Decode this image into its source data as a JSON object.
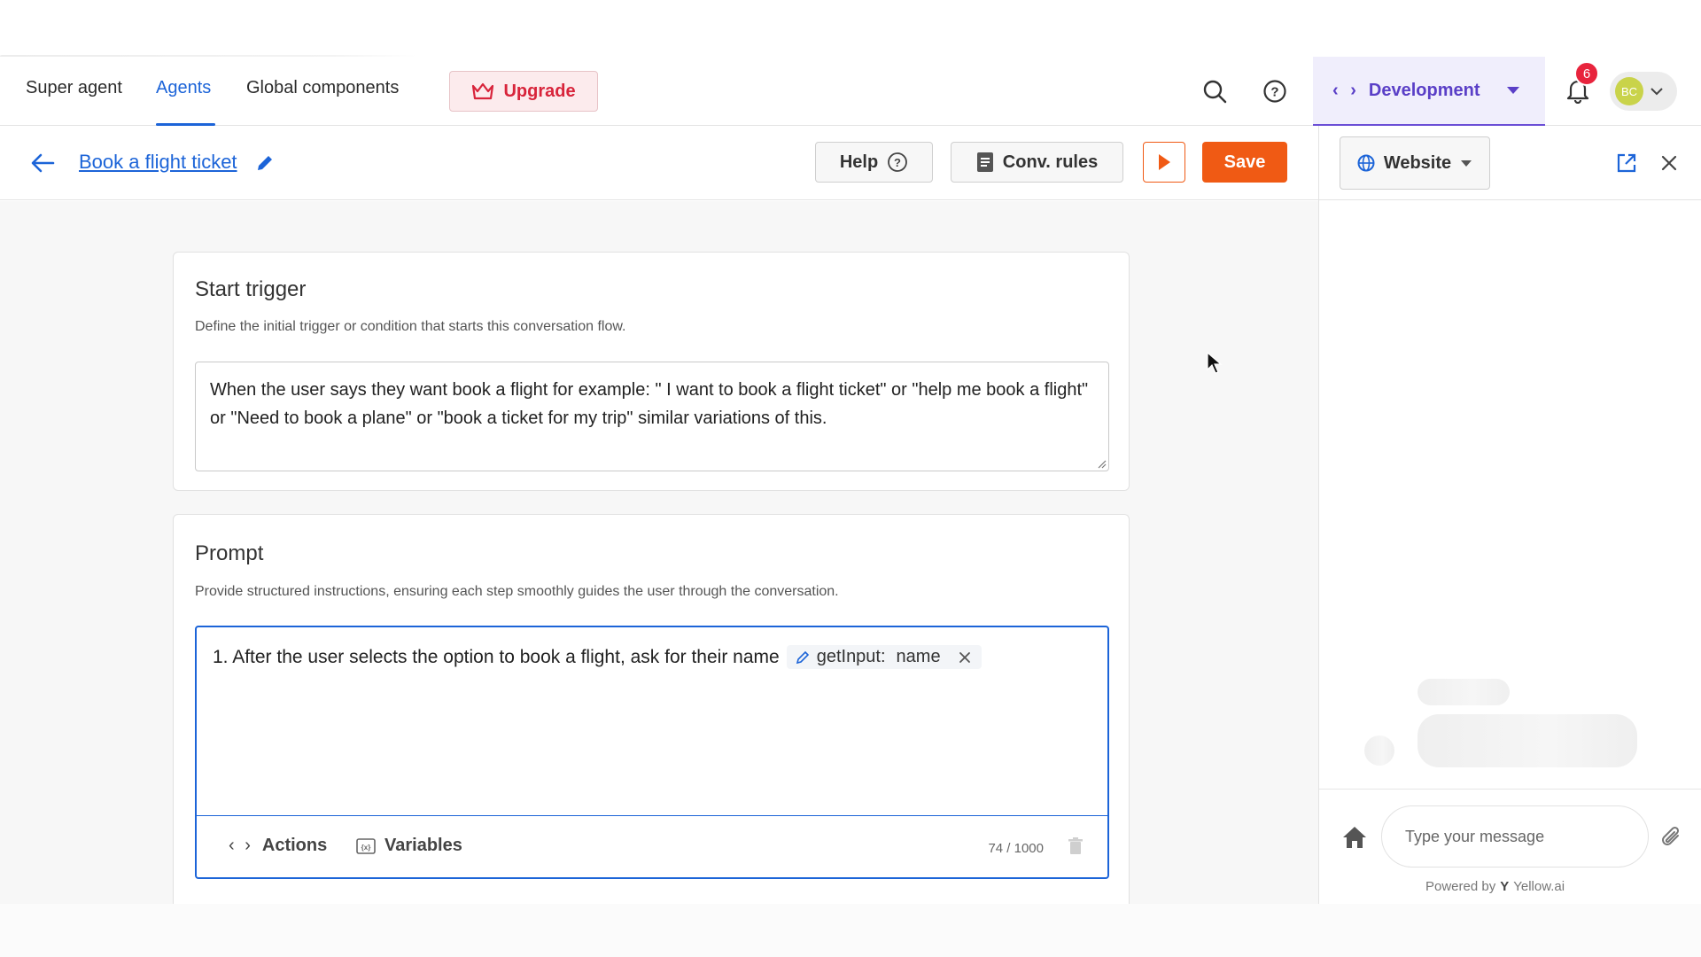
{
  "topnav": {
    "tabs": [
      {
        "label": "Super agent",
        "active": false
      },
      {
        "label": "Agents",
        "active": true
      },
      {
        "label": "Global components",
        "active": false
      }
    ],
    "upgrade_label": "Upgrade",
    "environment_label": "Development",
    "notification_count": "6",
    "avatar_initials": "BC"
  },
  "subbar": {
    "flow_title": "Book a flight ticket",
    "help_label": "Help",
    "conv_rules_label": "Conv. rules",
    "save_label": "Save"
  },
  "start_trigger": {
    "title": "Start trigger",
    "description": "Define the initial trigger or condition that starts this conversation flow.",
    "value": "When the user says they want book a flight for example:  \" I want to book a flight ticket\" or \"help me book a flight\" or \"Need to book a plane\"  or \"book a ticket for my trip\" similar variations of this."
  },
  "prompt": {
    "title": "Prompt",
    "description": "Provide structured instructions, ensuring each step smoothly guides the user through the conversation.",
    "line_text": "1. After the user selects the option to book a flight, ask for their name",
    "chip_function": "getInput:",
    "chip_value": "name",
    "actions_label": "Actions",
    "variables_label": "Variables",
    "char_count": "74 / 1000"
  },
  "preview": {
    "channel_label": "Website",
    "message_placeholder": "Type your message",
    "powered_by": "Powered by",
    "brand": "Yellow.ai"
  },
  "colors": {
    "accent": "#1c64d8",
    "save": "#f05a14",
    "upgrade": "#d8243b",
    "environment": "#5a3fc7"
  }
}
